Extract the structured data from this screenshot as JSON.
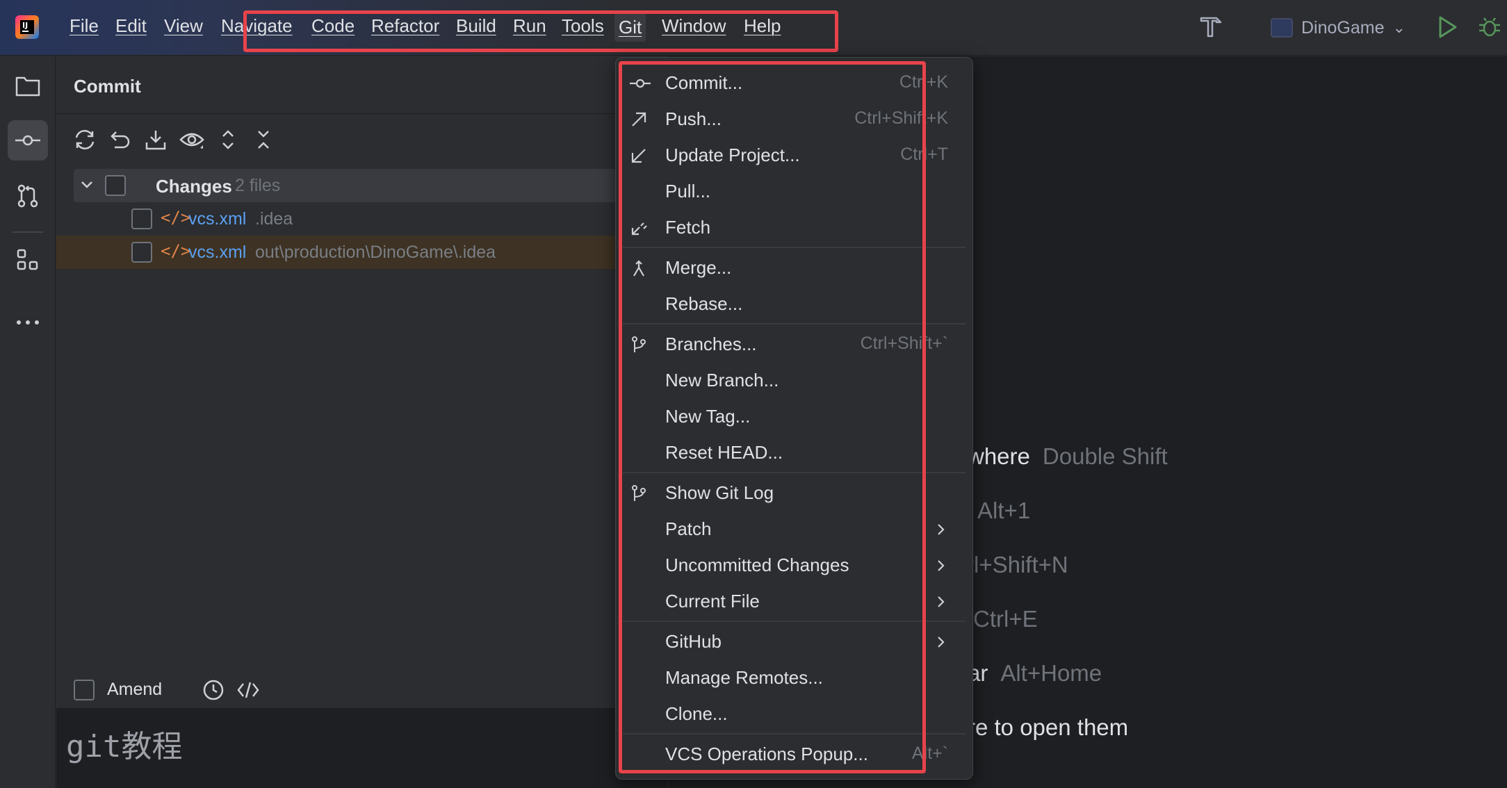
{
  "window": {
    "menu": [
      "File",
      "Edit",
      "View",
      "Navigate",
      "Code",
      "Refactor",
      "Build",
      "Run",
      "Tools",
      "Git",
      "Window",
      "Help"
    ],
    "active_menu": "Git",
    "project_name": "DinoGame"
  },
  "commit_panel": {
    "title": "Commit",
    "changes_label": "Changes",
    "changes_count": "2 files",
    "files": [
      {
        "name": "vcs.xml",
        "path": ".idea"
      },
      {
        "name": "vcs.xml",
        "path": "out\\production\\DinoGame\\.idea"
      }
    ],
    "amend_label": "Amend",
    "commit_message": "git教程"
  },
  "git_menu": {
    "items": [
      {
        "label": "Commit...",
        "shortcut": "Ctrl+K",
        "icon": "commit-icon"
      },
      {
        "label": "Push...",
        "shortcut": "Ctrl+Shift+K",
        "icon": "push-arrow-icon"
      },
      {
        "label": "Update Project...",
        "shortcut": "Ctrl+T",
        "icon": "update-arrow-icon"
      },
      {
        "label": "Pull...",
        "shortcut": "",
        "icon": ""
      },
      {
        "label": "Fetch",
        "shortcut": "",
        "icon": "fetch-icon"
      },
      {
        "label": "Merge...",
        "shortcut": "",
        "icon": "merge-icon"
      },
      {
        "label": "Rebase...",
        "shortcut": "",
        "icon": ""
      },
      {
        "label": "Branches...",
        "shortcut": "Ctrl+Shift+`",
        "icon": "branch-icon"
      },
      {
        "label": "New Branch...",
        "shortcut": "",
        "icon": ""
      },
      {
        "label": "New Tag...",
        "shortcut": "",
        "icon": ""
      },
      {
        "label": "Reset HEAD...",
        "shortcut": "",
        "icon": ""
      },
      {
        "label": "Show Git Log",
        "shortcut": "",
        "icon": "git-log-icon"
      },
      {
        "label": "Patch",
        "shortcut": "",
        "icon": "",
        "submenu": true
      },
      {
        "label": "Uncommitted Changes",
        "shortcut": "",
        "icon": "",
        "submenu": true
      },
      {
        "label": "Current File",
        "shortcut": "",
        "icon": "",
        "submenu": true
      },
      {
        "label": "GitHub",
        "shortcut": "",
        "icon": "",
        "submenu": true
      },
      {
        "label": "Manage Remotes...",
        "shortcut": "",
        "icon": ""
      },
      {
        "label": "Clone...",
        "shortcut": "",
        "icon": ""
      },
      {
        "label": "VCS Operations Popup...",
        "shortcut": "Alt+`",
        "icon": ""
      }
    ]
  },
  "editor_hints": [
    {
      "text": "where",
      "key": "Double Shift"
    },
    {
      "text": "",
      "key": "Alt+1"
    },
    {
      "text": "",
      "key": "rl+Shift+N"
    },
    {
      "text": "",
      "key": "Ctrl+E"
    },
    {
      "text": "ar",
      "key": "Alt+Home"
    },
    {
      "text": "re to open them",
      "key": ""
    }
  ],
  "colors": {
    "highlight": "#e8434b",
    "accent_blue": "#5ca0f2",
    "file_icon": "#e0844a",
    "run_green": "#57965c"
  }
}
